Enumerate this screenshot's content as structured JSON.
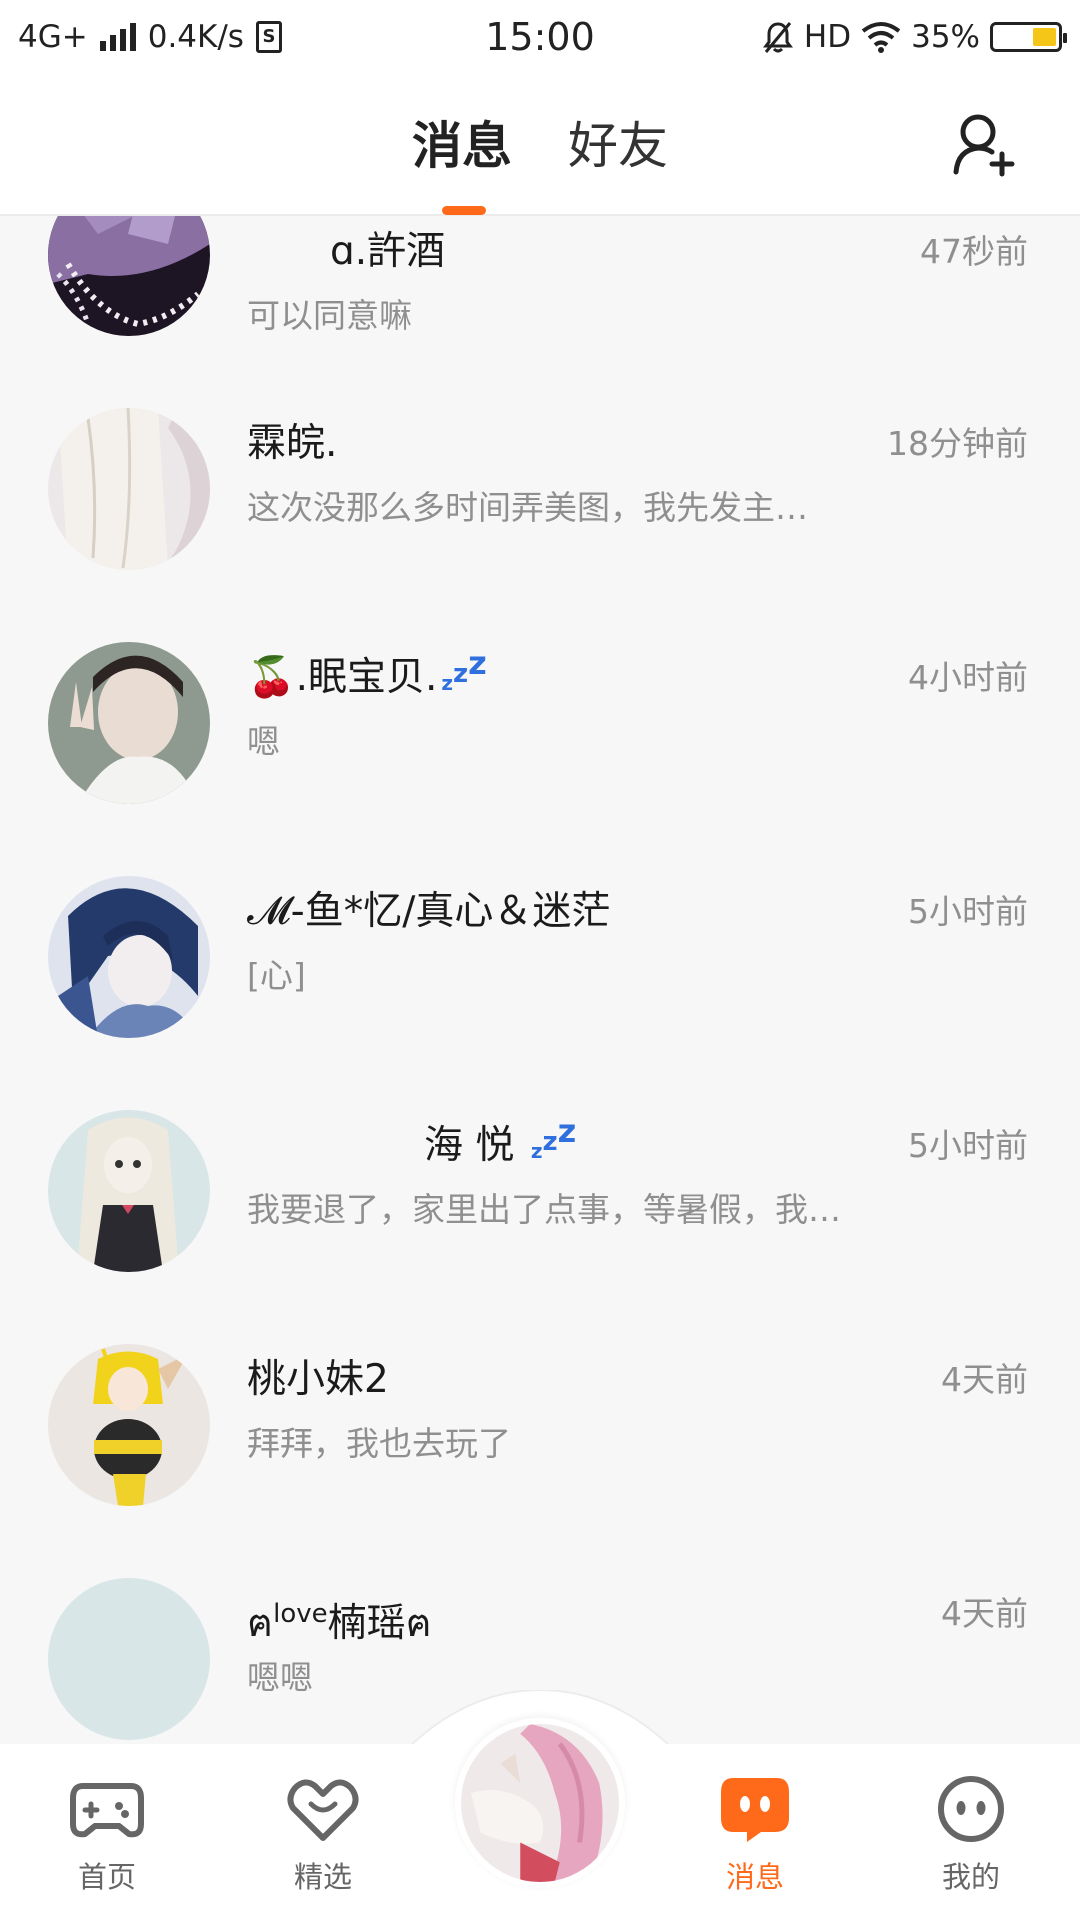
{
  "status_bar": {
    "network": "4G+",
    "speed": "0.4K/s",
    "sim_icon_label": "S",
    "time": "15:00",
    "hd": "HD",
    "battery_percent": "35%",
    "battery_level": 0.35
  },
  "header": {
    "tabs": [
      {
        "label": "消息",
        "active": true
      },
      {
        "label": "好友",
        "active": false
      }
    ],
    "accent_color": "#ff6a1a",
    "add_friend_icon": "add-user-icon"
  },
  "conversations": [
    {
      "name": "ɑ.許酒",
      "preview": "可以同意嘛",
      "time": "47秒前"
    },
    {
      "name": "霖皖.",
      "preview": "这次没那么多时间弄美图，我先发主…",
      "time": "18分钟前"
    },
    {
      "name_prefix": "🍒",
      "name": ".眠宝贝.",
      "preview": "嗯",
      "time": "4小时前"
    },
    {
      "name": "𝓜-鱼*忆/真心＆迷茫",
      "preview": "[心]",
      "time": "5小时前"
    },
    {
      "name": "海 悦",
      "preview": "我要退了，家里出了点事，等暑假，我…",
      "time": "5小时前"
    },
    {
      "name": "桃小妹2",
      "preview": "拜拜，我也去玩了",
      "time": "4天前"
    },
    {
      "name_a": "ฅ",
      "name_sup": "love",
      "name_b": "楠瑶ฅ",
      "preview": "嗯嗯",
      "time": "4天前"
    }
  ],
  "bottom_nav": [
    {
      "label": "首页",
      "icon": "gamepad-icon",
      "active": false
    },
    {
      "label": "精选",
      "icon": "heart-chat-icon",
      "active": false
    },
    {
      "label": "",
      "icon": "center-avatar",
      "active": false
    },
    {
      "label": "消息",
      "icon": "message-icon",
      "active": true
    },
    {
      "label": "我的",
      "icon": "face-icon",
      "active": false
    }
  ]
}
